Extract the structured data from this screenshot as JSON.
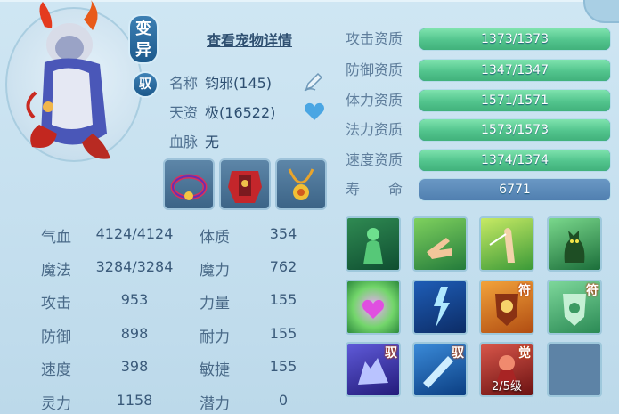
{
  "pet": {
    "badge_change": "变\n异",
    "badge_ride": "驭",
    "view_details": "查看宠物详情",
    "name_label": "名称",
    "name_value": "钧邪(145)",
    "talent_label": "天资",
    "talent_value": "极(16522)",
    "bloodline_label": "血脉",
    "bloodline_value": "无"
  },
  "stats": [
    {
      "label": "气血",
      "value": "4124/4124"
    },
    {
      "label": "魔法",
      "value": "3284/3284"
    },
    {
      "label": "攻击",
      "value": "953"
    },
    {
      "label": "防御",
      "value": "898"
    },
    {
      "label": "速度",
      "value": "398"
    },
    {
      "label": "灵力",
      "value": "1158"
    }
  ],
  "attrs": [
    {
      "label": "体质",
      "value": "354"
    },
    {
      "label": "魔力",
      "value": "762"
    },
    {
      "label": "力量",
      "value": "155"
    },
    {
      "label": "耐力",
      "value": "155"
    },
    {
      "label": "敏捷",
      "value": "155"
    },
    {
      "label": "潜力",
      "value": "0"
    }
  ],
  "qualities": [
    {
      "label": "攻击资质",
      "text": "1373/1373",
      "fill": 1.0
    },
    {
      "label": "防御资质",
      "text": "1347/1347",
      "fill": 1.0
    },
    {
      "label": "体力资质",
      "text": "1571/1571",
      "fill": 1.0
    },
    {
      "label": "法力资质",
      "text": "1573/1573",
      "fill": 1.0
    },
    {
      "label": "速度资质",
      "text": "1374/1374",
      "fill": 1.0
    }
  ],
  "life": {
    "label": "寿　　命",
    "value": "6771"
  },
  "skills": [
    {
      "icon": "green-figure-skill-icon",
      "tag": ""
    },
    {
      "icon": "pointing-hand-skill-icon",
      "tag": ""
    },
    {
      "icon": "raised-palm-skill-icon",
      "tag": ""
    },
    {
      "icon": "cat-silhouette-skill-icon",
      "tag": ""
    },
    {
      "icon": "heart-burst-skill-icon",
      "tag": ""
    },
    {
      "icon": "lightning-skill-icon",
      "tag": ""
    },
    {
      "icon": "shield-face-skill-icon",
      "tag": "符"
    },
    {
      "icon": "green-shield-skill-icon",
      "tag": "符"
    },
    {
      "icon": "wolf-skill-icon",
      "tag": "驭"
    },
    {
      "icon": "blue-strike-skill-icon",
      "tag": "驭"
    },
    {
      "icon": "red-awaken-skill-icon",
      "tag": "觉",
      "level": "2/5级"
    },
    {
      "icon": "empty-skill-slot",
      "tag": ""
    }
  ],
  "colors": {
    "bar_green": "#52c48d",
    "bar_blue": "#2e6aa0",
    "panel_bg": "#c6e0ef"
  }
}
